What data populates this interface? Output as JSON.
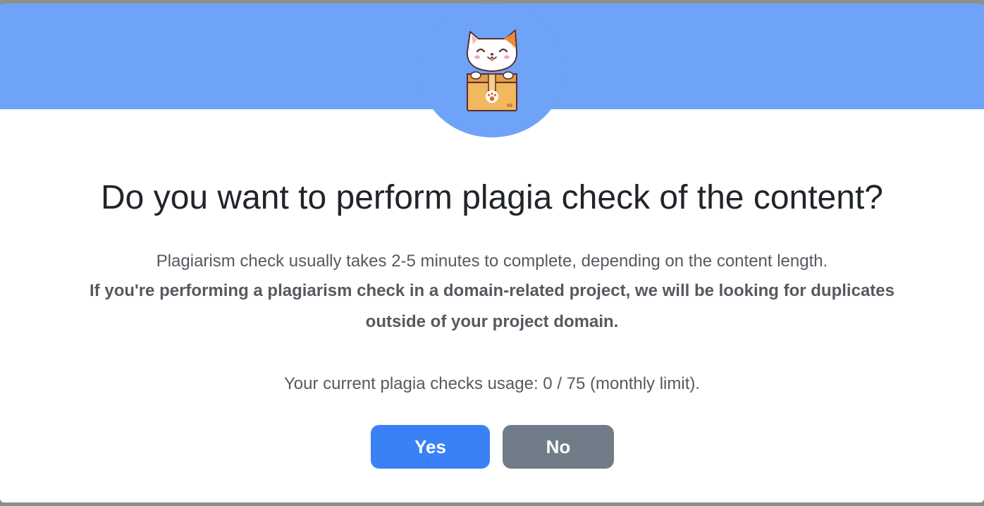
{
  "dialog": {
    "mascot_icon": "cat-in-box-icon",
    "title": "Do you want to perform plagia check of the content?",
    "description": "Plagiarism check usually takes 2-5 minutes to complete, depending on the content length.",
    "bold_note": "If you're performing a plagiarism check in a domain-related project, we will be looking for duplicates outside of your project domain.",
    "usage_text": "Your current plagia checks usage: 0 / 75 (monthly limit).",
    "yes_label": "Yes",
    "no_label": "No"
  },
  "colors": {
    "header": "#6fa3f8",
    "yes_button": "#3a81f5",
    "no_button": "#707d88"
  }
}
